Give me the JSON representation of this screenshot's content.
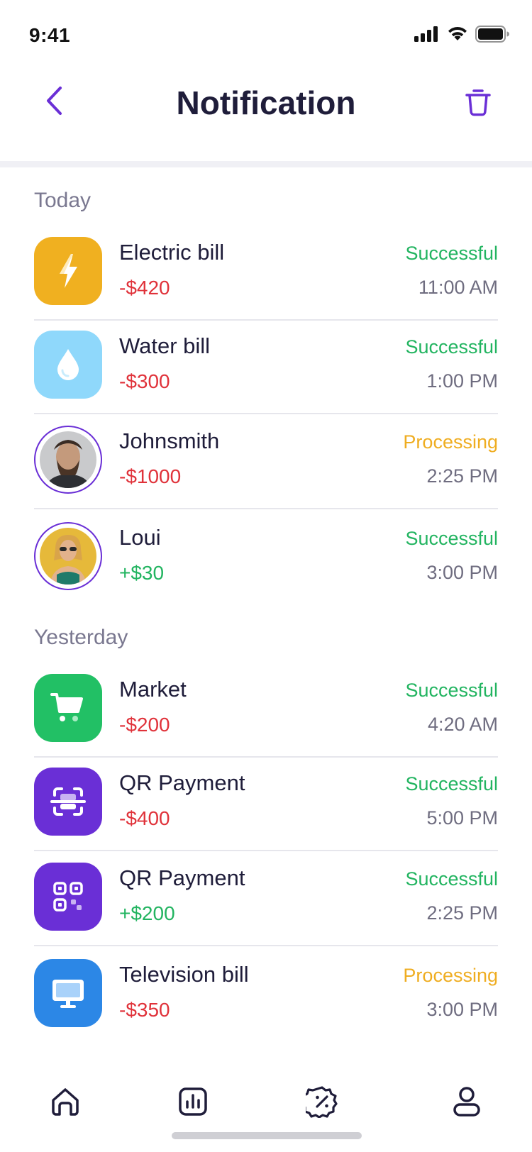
{
  "status_bar": {
    "time": "9:41"
  },
  "header": {
    "title": "Notification"
  },
  "sections": [
    {
      "label": "Today",
      "items": [
        {
          "title": "Electric bill",
          "amount": "-$420",
          "status": "Successful",
          "time": "11:00 AM",
          "icon": "lightning-icon",
          "color": "#f0b020"
        },
        {
          "title": "Water bill",
          "amount": "-$300",
          "status": "Successful",
          "time": "1:00 PM",
          "icon": "water-drop-icon",
          "color": "#8fd8fb"
        },
        {
          "title": "Johnsmith",
          "amount": "-$1000",
          "status": "Processing",
          "time": "2:25 PM",
          "icon": "avatar-johnsmith"
        },
        {
          "title": "Loui",
          "amount": "+$30",
          "status": "Successful",
          "time": "3:00 PM",
          "icon": "avatar-loui"
        }
      ]
    },
    {
      "label": "Yesterday",
      "items": [
        {
          "title": "Market",
          "amount": "-$200",
          "status": "Successful",
          "time": "4:20 AM",
          "icon": "cart-icon",
          "color": "#22c065"
        },
        {
          "title": "QR Payment",
          "amount": "-$400",
          "status": "Successful",
          "time": "5:00 PM",
          "icon": "scan-icon",
          "color": "#6a2fd6"
        },
        {
          "title": "QR Payment",
          "amount": "+$200",
          "status": "Successful",
          "time": "2:25 PM",
          "icon": "qr-code-icon",
          "color": "#6a2fd6"
        },
        {
          "title": "Television bill",
          "amount": "-$350",
          "status": "Processing",
          "time": "3:00 PM",
          "icon": "monitor-icon",
          "color": "#2c87e6"
        }
      ]
    }
  ],
  "bottom_nav": [
    "home-icon",
    "chart-icon",
    "discount-icon",
    "profile-icon"
  ],
  "colors": {
    "accent": "#6a2fd6",
    "negative": "#e0323a",
    "positive": "#22b460",
    "processing": "#efad21"
  }
}
